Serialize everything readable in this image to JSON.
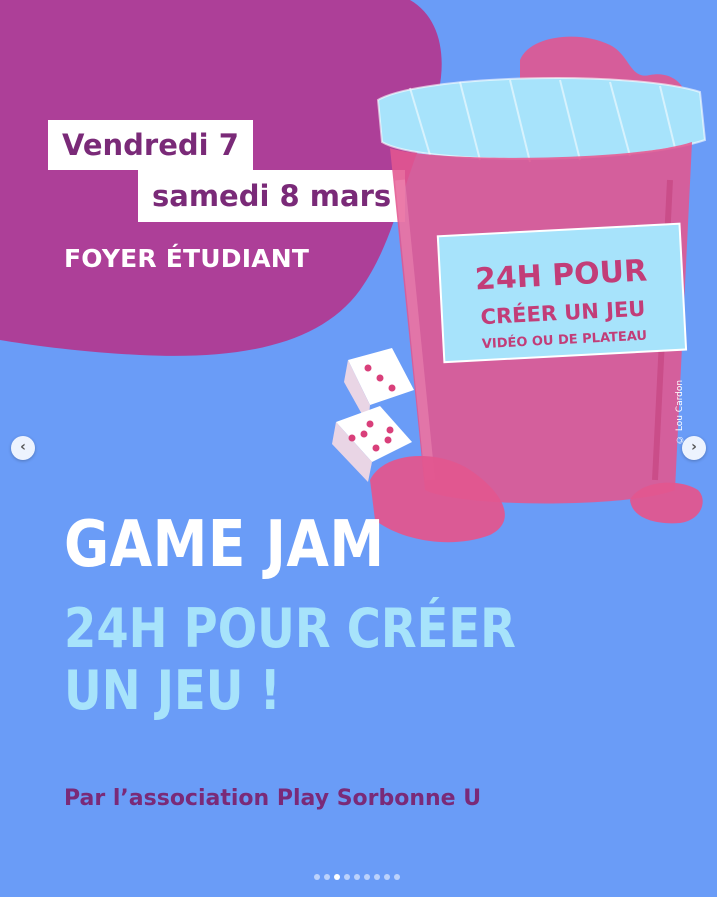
{
  "event": {
    "date_line1": "Vendredi 7",
    "date_line2": "samedi 8 mars",
    "venue": "FOYER ÉTUDIANT",
    "title": "GAME JAM",
    "subtitle_line1": "24H POUR CRÉER",
    "subtitle_line2": "UN JEU !",
    "organizer": "Par l’association Play Sorbonne U"
  },
  "jar_label": {
    "line1": "24H POUR",
    "line2": "CRÉER UN JEU",
    "line3": "VIDÉO OU DE PLATEAU"
  },
  "photo_credit": "© Lou Cardon",
  "carousel": {
    "prev_icon": "‹",
    "next_icon": "›",
    "dots": 9,
    "active_dot": 3
  },
  "colors": {
    "background": "#6a9cf7",
    "blob": "#ad3f98",
    "date_text": "#7a2a78",
    "subtitle": "#a7e3fb",
    "jar_pink": "#e2568f"
  }
}
